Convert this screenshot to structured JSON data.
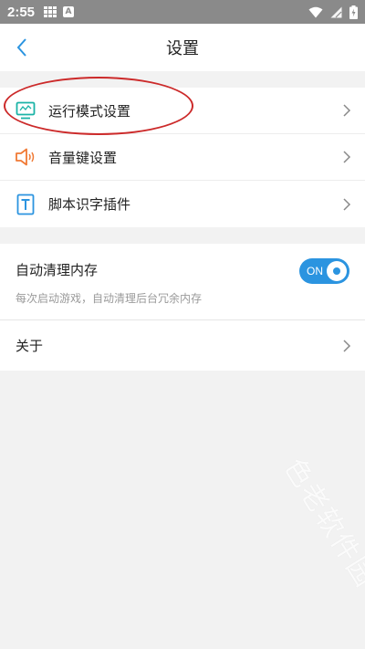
{
  "status_bar": {
    "time": "2:55",
    "a_icon_letter": "A",
    "icons": [
      "grid-icon",
      "a-icon",
      "wifi-icon",
      "no-sim-icon",
      "battery-charging-icon"
    ]
  },
  "header": {
    "title": "设置",
    "back_icon": "chevron-left-icon"
  },
  "settings_group": {
    "items": [
      {
        "label": "运行模式设置",
        "icon": "monitor-icon",
        "highlighted": true
      },
      {
        "label": "音量键设置",
        "icon": "speaker-icon"
      },
      {
        "label": "脚本识字插件",
        "icon": "text-t-icon"
      }
    ]
  },
  "memory_group": {
    "auto_clean": {
      "title": "自动清理内存",
      "description": "每次启动游戏，自动清理后台冗余内存",
      "toggle_label": "ON",
      "enabled": true
    },
    "about": {
      "label": "关于"
    }
  },
  "watermark": "色老软件园",
  "colors": {
    "accent_blue": "#2b94e0",
    "teal_icon": "#1ab3a6",
    "orange_icon": "#f07a35",
    "highlight_red": "#cc2a2a",
    "status_bar_bg": "#8a8a8a"
  }
}
